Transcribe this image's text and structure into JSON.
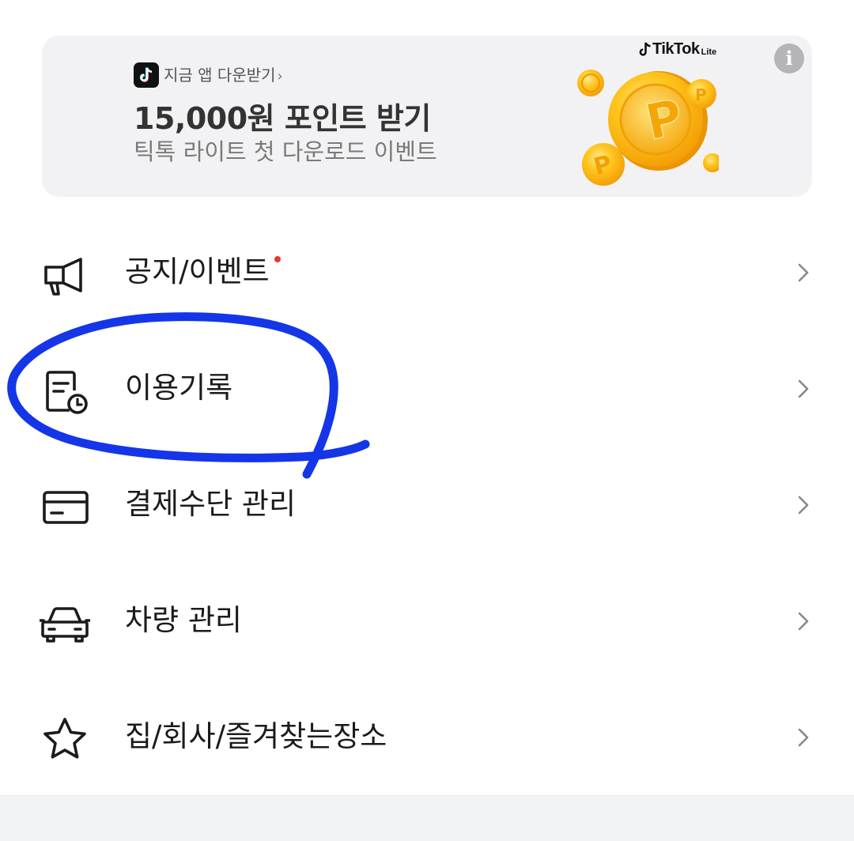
{
  "banner": {
    "cta": "지금 앱 다운받기",
    "cta_chevron": "›",
    "headline": "15,000원 포인트 받기",
    "subtitle": "틱톡 라이트 첫 다운로드 이벤트",
    "brand_name": "TikTok",
    "brand_suffix": "Lite",
    "info_glyph": "i",
    "coin_letter": "P"
  },
  "menu": {
    "items": [
      {
        "label": "공지/이벤트",
        "icon": "megaphone-icon",
        "has_new_dot": true
      },
      {
        "label": "이용기록",
        "icon": "history-document-icon",
        "has_new_dot": false
      },
      {
        "label": "결제수단 관리",
        "icon": "credit-card-icon",
        "has_new_dot": false
      },
      {
        "label": "차량 관리",
        "icon": "car-icon",
        "has_new_dot": false
      },
      {
        "label": "집/회사/즐겨찾는장소",
        "icon": "star-icon",
        "has_new_dot": false
      }
    ]
  },
  "colors": {
    "banner_bg": "#f2f2f4",
    "new_dot": "#e53935",
    "annotation": "#1436e8",
    "coin_gold": "#ffc21a"
  }
}
